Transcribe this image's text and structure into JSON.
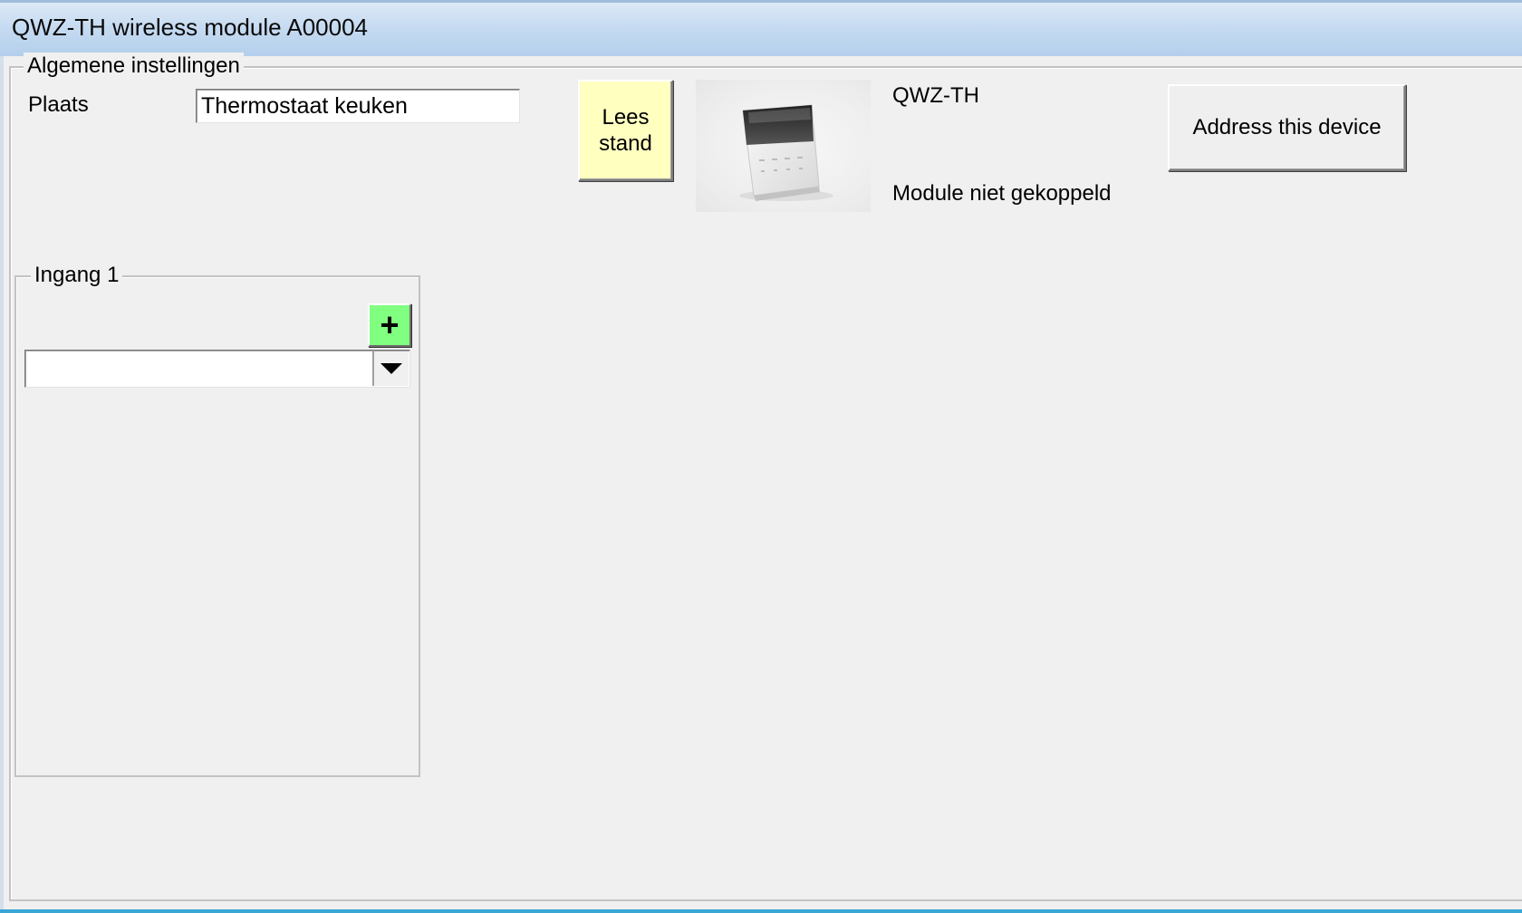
{
  "window": {
    "title": "QWZ-TH wireless module A00004"
  },
  "general": {
    "group_label": "Algemene instellingen",
    "place_label": "Plaats",
    "place_value": "Thermostaat keuken",
    "read_button_label": "Lees\nstand",
    "device_type": "QWZ-TH",
    "status_text": "Module niet gekoppeld",
    "address_button_label": "Address this device",
    "device_image_icon": "thermostat-device-photo"
  },
  "input1": {
    "group_label": "Ingang 1",
    "add_button_label": "+",
    "add_button_color": "#80ff80",
    "selected_value": ""
  },
  "colors": {
    "read_button_bg": "#ffffc0",
    "window_bg": "#f0f0f0"
  }
}
